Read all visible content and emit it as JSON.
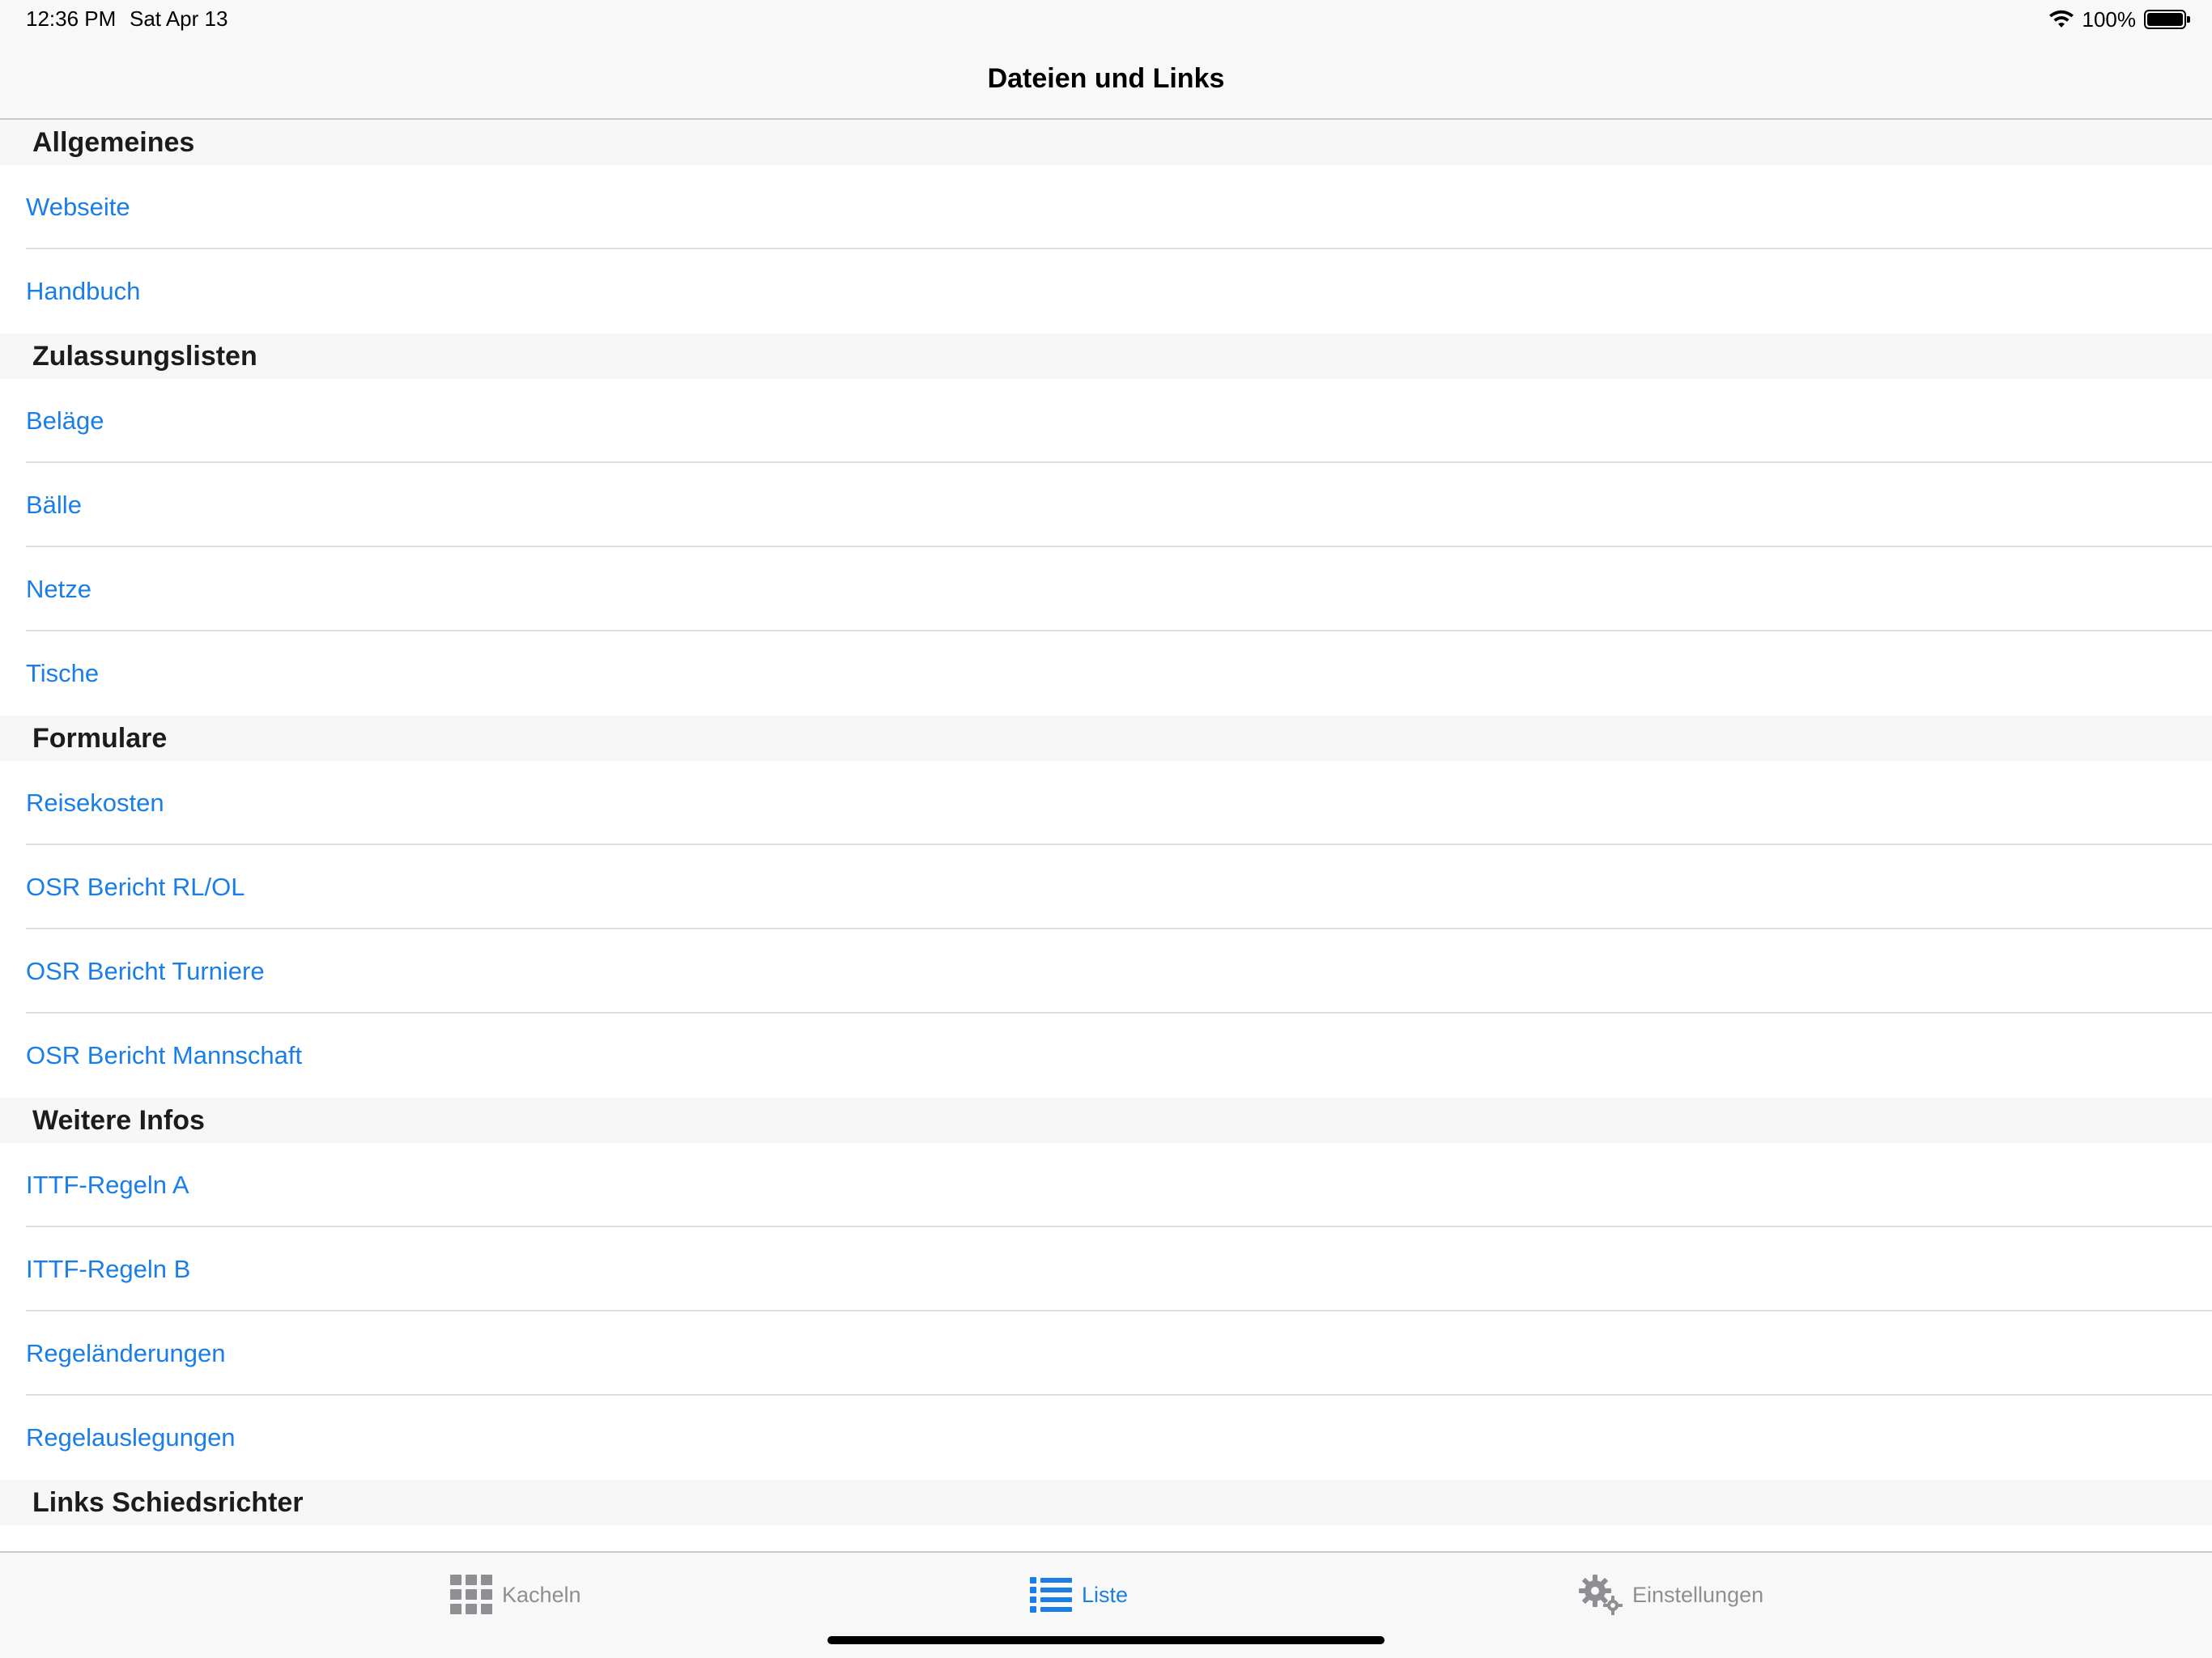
{
  "status": {
    "time": "12:36 PM",
    "date": "Sat Apr 13",
    "battery": "100%",
    "battery_level": 1.0
  },
  "nav": {
    "title": "Dateien und Links"
  },
  "sections": [
    {
      "header": "Allgemeines",
      "items": [
        "Webseite",
        "Handbuch"
      ]
    },
    {
      "header": "Zulassungslisten",
      "items": [
        "Beläge",
        "Bälle",
        "Netze",
        "Tische"
      ]
    },
    {
      "header": "Formulare",
      "items": [
        "Reisekosten",
        "OSR Bericht RL/OL",
        "OSR Bericht Turniere",
        "OSR Bericht Mannschaft"
      ]
    },
    {
      "header": "Weitere Infos",
      "items": [
        "ITTF-Regeln A",
        "ITTF-Regeln B",
        "Regeländerungen",
        "Regelauslegungen"
      ]
    },
    {
      "header": "Links Schiedsrichter",
      "items": []
    }
  ],
  "tabs": [
    {
      "label": "Kacheln",
      "icon": "grid-icon",
      "active": false
    },
    {
      "label": "Liste",
      "icon": "list-icon",
      "active": true
    },
    {
      "label": "Einstellungen",
      "icon": "gear-icon",
      "active": false
    }
  ],
  "colors": {
    "accent": "#1a7ee6",
    "inactive": "#8e8e93",
    "header_bg": "#f7f7f7"
  }
}
